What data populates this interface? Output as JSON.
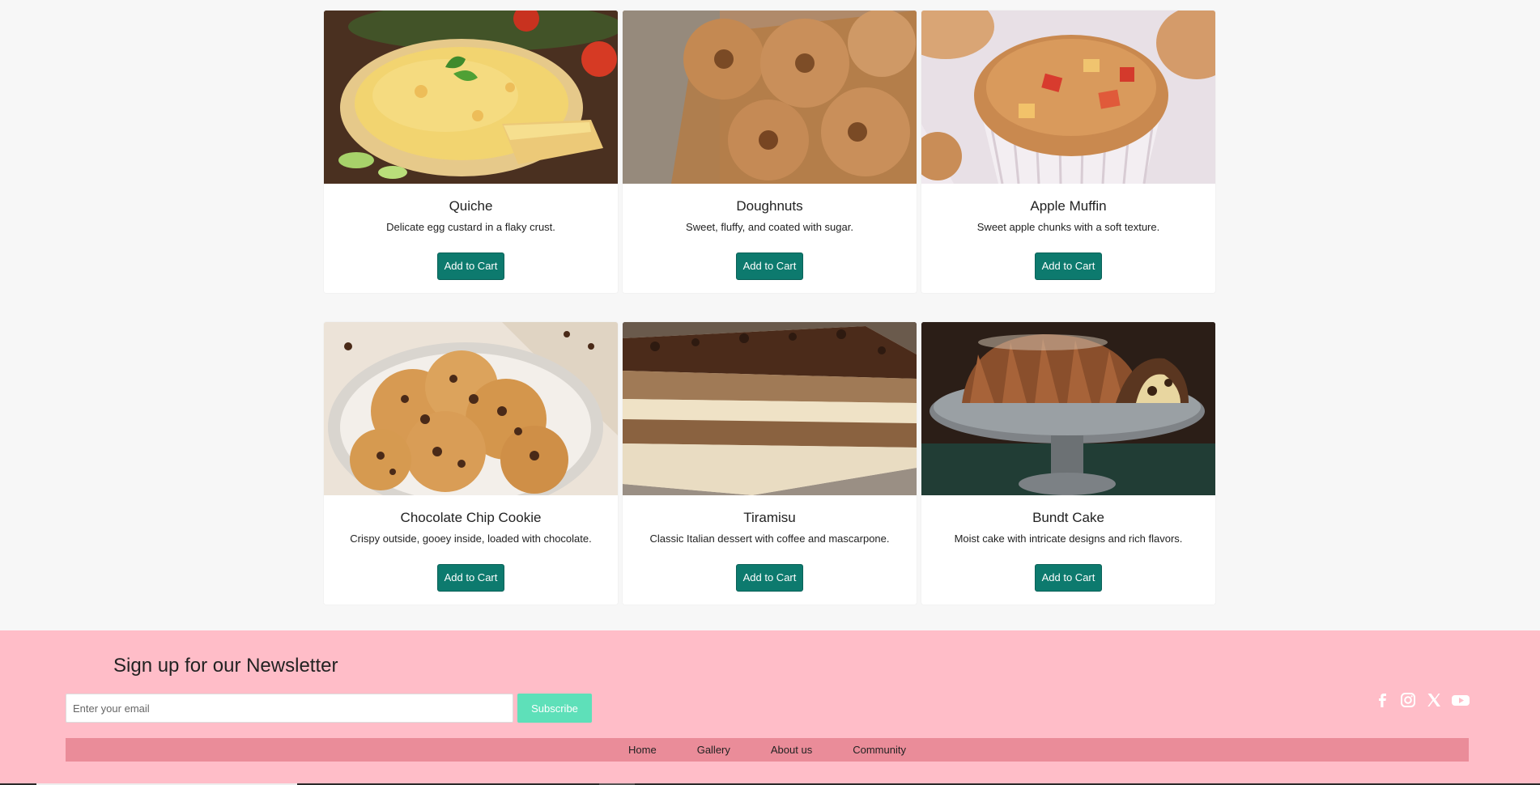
{
  "products": [
    {
      "name": "Quiche",
      "description": "Delicate egg custard in a flaky crust.",
      "button": "Add to Cart",
      "image_icon": "quiche-image"
    },
    {
      "name": "Doughnuts",
      "description": "Sweet, fluffy, and coated with sugar.",
      "button": "Add to Cart",
      "image_icon": "doughnuts-image"
    },
    {
      "name": "Apple Muffin",
      "description": "Sweet apple chunks with a soft texture.",
      "button": "Add to Cart",
      "image_icon": "apple-muffin-image"
    },
    {
      "name": "Chocolate Chip Cookie",
      "description": "Crispy outside, gooey inside, loaded with chocolate.",
      "button": "Add to Cart",
      "image_icon": "cookie-image"
    },
    {
      "name": "Tiramisu",
      "description": "Classic Italian dessert with coffee and mascarpone.",
      "button": "Add to Cart",
      "image_icon": "tiramisu-image"
    },
    {
      "name": "Bundt Cake",
      "description": "Moist cake with intricate designs and rich flavors.",
      "button": "Add to Cart",
      "image_icon": "bundt-cake-image"
    }
  ],
  "footer": {
    "newsletter_title": "Sign up for our Newsletter",
    "email_placeholder": "Enter your email",
    "subscribe_label": "Subscribe",
    "social": [
      "facebook-icon",
      "instagram-icon",
      "x-icon",
      "youtube-icon"
    ],
    "nav": [
      {
        "label": "Home"
      },
      {
        "label": "Gallery"
      },
      {
        "label": "About us"
      },
      {
        "label": "Community"
      }
    ]
  },
  "colors": {
    "page_bg": "#f7f7f7",
    "button_teal": "#0d7a6e",
    "footer_bg": "#ffbdc8",
    "footer_nav_bg": "#ea8c99",
    "subscribe_bg": "#5ee0b9"
  }
}
